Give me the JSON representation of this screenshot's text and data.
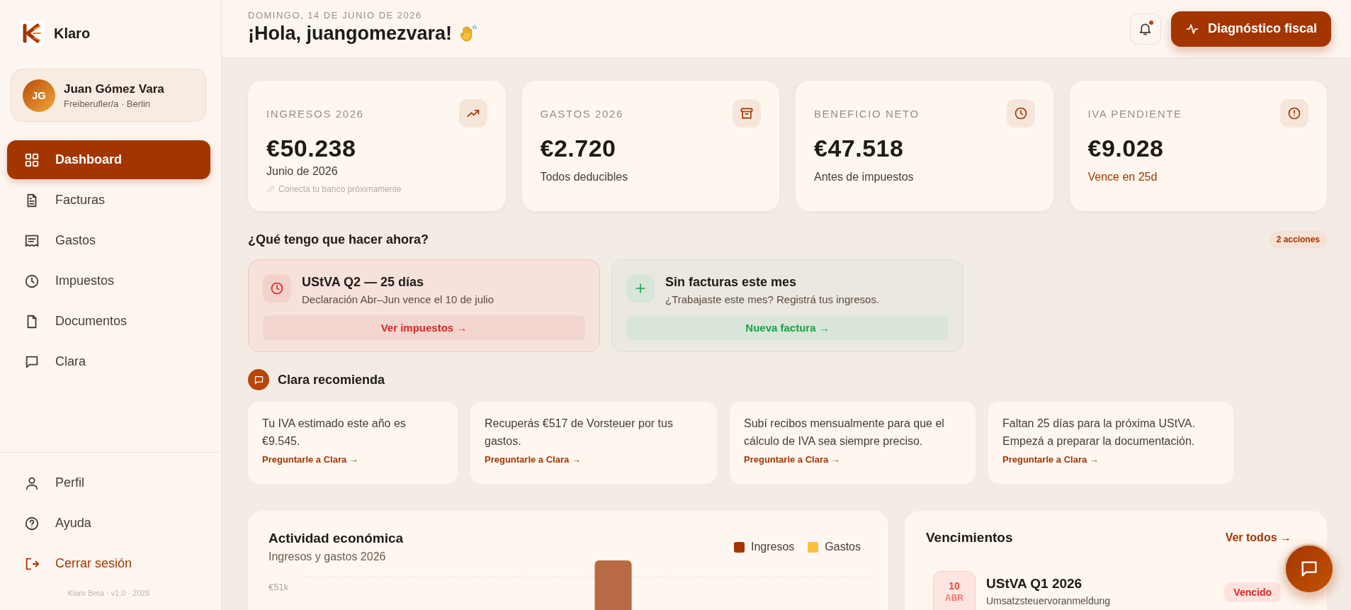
{
  "sidebar": {
    "logo": {
      "text": "Klaro"
    },
    "user": {
      "initials": "JG",
      "name": "Juan Gómez Vara",
      "subtitle": "Freiberufler/a · Berlin"
    },
    "nav": [
      {
        "label": "Dashboard",
        "selected": true
      },
      {
        "label": "Facturas",
        "selected": false
      },
      {
        "label": "Gastos",
        "selected": false
      },
      {
        "label": "Impuestos",
        "selected": false
      },
      {
        "label": "Documentos",
        "selected": false
      },
      {
        "label": "Clara",
        "selected": false
      }
    ],
    "bottom_nav": [
      {
        "label": "Perfil",
        "kind": "link"
      },
      {
        "label": "Ayuda",
        "kind": "link"
      },
      {
        "label": "Cerrar sesión",
        "kind": "logout"
      }
    ],
    "footer": "Klaro Beta · v1.0 · 2026"
  },
  "header": {
    "date": "DOMINGO, 14 DE JUNIO DE 2026",
    "greeting": "¡Hola, juangomezvara!",
    "notifications": {
      "unread": true
    },
    "primary_button": "Diagnóstico fiscal"
  },
  "stats": [
    {
      "label": "INGRESOS 2026",
      "value": "€50.238",
      "note": "Junio de 2026",
      "alert": false,
      "hint": "Conecta tu banco próximamente"
    },
    {
      "label": "GASTOS 2026",
      "value": "€2.720",
      "note": "Todos deducibles",
      "alert": false
    },
    {
      "label": "BENEFICIO NETO",
      "value": "€47.518",
      "note": "Antes de impuestos",
      "alert": false
    },
    {
      "label": "IVA PENDIENTE",
      "value": "€9.028",
      "note": "Vence en 25d",
      "alert": true
    }
  ],
  "actions": {
    "title": "¿Qué tengo que hacer ahora?",
    "count": "2 acciones",
    "items": [
      {
        "kind": "alert",
        "title": "UStVA Q2 — 25 días",
        "text": "Declaración Abr–Jun vence el 10 de julio",
        "button": "Ver impuestos →"
      },
      {
        "kind": "success",
        "title": "Sin facturas este mes",
        "text": "¿Trabajaste este mes? Registrá tus ingresos.",
        "button": "Nueva factura →"
      }
    ]
  },
  "recommendations": {
    "title": "Clara recomienda",
    "items": [
      {
        "text": "Tu IVA estimado este año es €9.545.",
        "link": "Preguntarle a Clara →"
      },
      {
        "text": "Recuperás €517 de Vorsteuer por tus gastos.",
        "link": "Preguntarle a Clara →"
      },
      {
        "text": "Subí recibos mensualmente para que el cálculo de IVA sea siempre preciso.",
        "link": "Preguntarle a Clara →"
      },
      {
        "text": "Faltan 25 días para la próxima UStVA. Empezá a preparar la documentación.",
        "link": "Preguntarle a Clara →"
      }
    ]
  },
  "activity": {
    "title": "Actividad económica",
    "subtitle": "Ingresos y gastos 2026",
    "legend": [
      {
        "label": "Ingresos",
        "color": "#a33600"
      },
      {
        "label": "Gastos",
        "color": "#fbbf3a"
      }
    ],
    "y_tick": "€51k"
  },
  "due": {
    "title": "Vencimientos",
    "link": "Ver todos →",
    "items": [
      {
        "day": "10",
        "month": "ABR",
        "title": "UStVA Q1 2026",
        "subtitle": "Umsatzsteuervoranmeldung",
        "status": "Vencido",
        "kind": "overdue"
      }
    ]
  }
}
